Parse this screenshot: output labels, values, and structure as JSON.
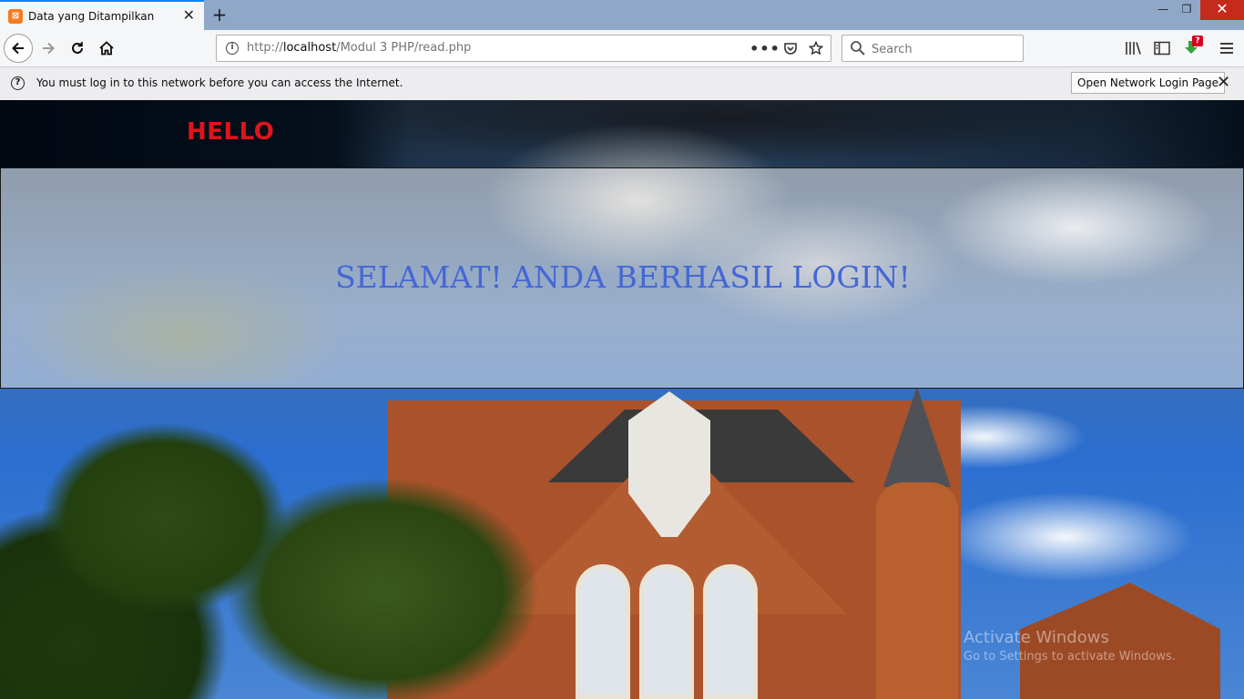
{
  "tab": {
    "title": "Data yang Ditampilkan",
    "favicon": "xampp-icon"
  },
  "window": {
    "minimize": "—",
    "restore": "❐",
    "close": "✕"
  },
  "nav": {
    "url_prefix": "http://",
    "url_host": "localhost",
    "url_path": "/Modul 3 PHP/read.php"
  },
  "search": {
    "placeholder": "Search"
  },
  "notification": {
    "text": "You must log in to this network before you can access the Internet.",
    "button": "Open Network Login Page"
  },
  "page": {
    "hello": "HELLO",
    "message": "SELAMAT! ANDA BERHASIL LOGIN!",
    "hello_color": "#e0141c",
    "message_color": "#4567d6"
  },
  "watermark": {
    "line1": "Activate Windows",
    "line2": "Go to Settings to activate Windows."
  },
  "badges": {
    "downloads": "?"
  },
  "colors": {
    "accent": "#0a84ff",
    "tabstrip": "#90a8c8",
    "close_red": "#c42b1c"
  }
}
